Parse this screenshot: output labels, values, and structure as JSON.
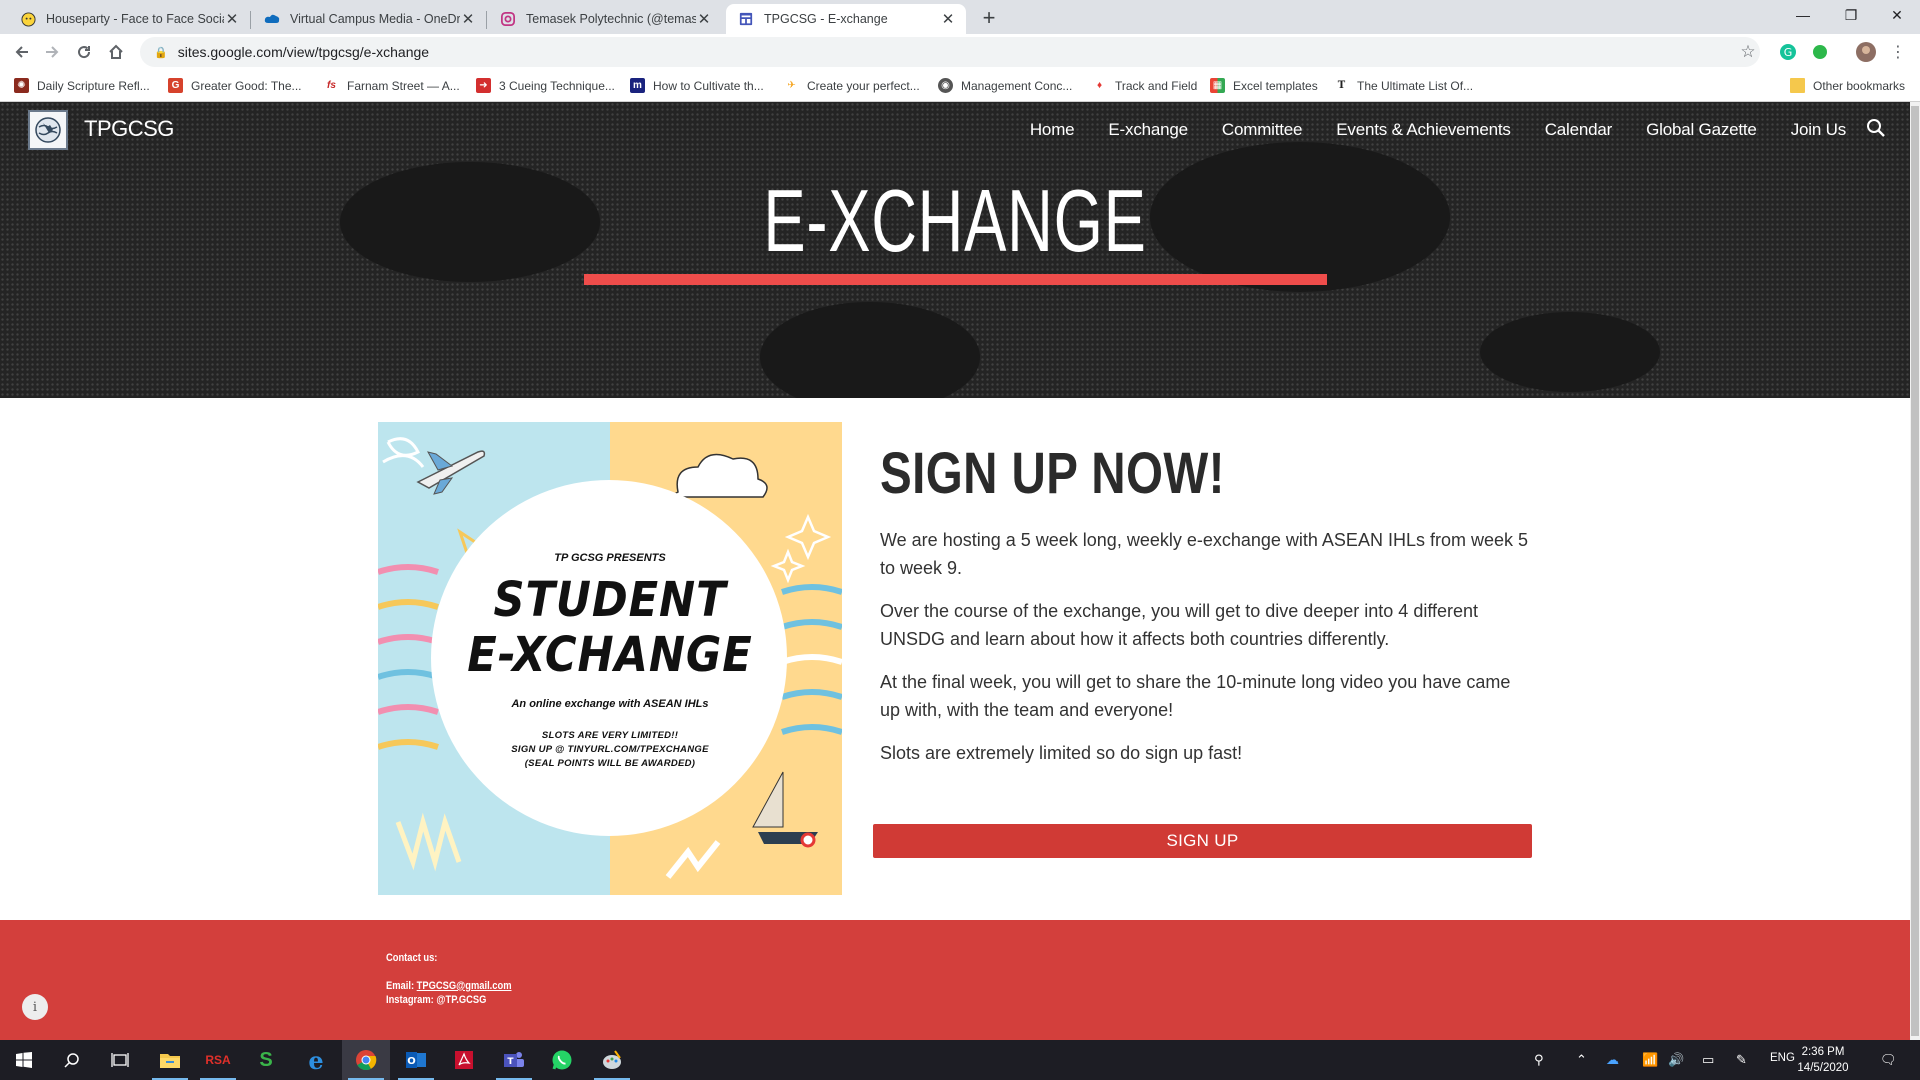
{
  "browser": {
    "tabs": [
      {
        "title": "Houseparty - Face to Face Social",
        "icon": "houseparty-icon",
        "active": false
      },
      {
        "title": "Virtual Campus Media - OneDrive",
        "icon": "onedrive-icon",
        "active": false
      },
      {
        "title": "Temasek Polytechnic (@temasekp",
        "icon": "instagram-icon",
        "active": false
      },
      {
        "title": "TPGCSG - E-xchange",
        "icon": "google-sites-icon",
        "active": true
      }
    ],
    "url": "sites.google.com/view/tpgcsg/e-xchange",
    "bookmarks": [
      {
        "label": "Daily Scripture Refl...",
        "color": "#8b2a1e"
      },
      {
        "label": "Greater Good: The...",
        "color": "#d6422c"
      },
      {
        "label": "Farnam Street — A...",
        "color": "#c62828"
      },
      {
        "label": "3 Cueing Technique...",
        "color": "#d32f2f"
      },
      {
        "label": "How to Cultivate th...",
        "color": "#1a237e"
      },
      {
        "label": "Create your perfect...",
        "color": "#f5a623"
      },
      {
        "label": "Management Conc...",
        "color": "#555555"
      },
      {
        "label": "Track and Field",
        "color": "#e53935"
      },
      {
        "label": "Excel templates",
        "color": "#2e7d32"
      },
      {
        "label": "The Ultimate List Of...",
        "color": "#222222"
      }
    ],
    "other_bookmarks": "Other bookmarks"
  },
  "site": {
    "name": "TPGCSG",
    "nav": [
      "Home",
      "E-xchange",
      "Committee",
      "Events & Achievements",
      "Calendar",
      "Global Gazette",
      "Join Us"
    ],
    "page_title": "E-XCHANGE",
    "accent_color": "#ef4d4b"
  },
  "poster": {
    "presents": "TP GCSG PRESENTS",
    "title_line1": "STUDENT",
    "title_line2": "E-XCHANGE",
    "subtitle": "An online exchange with ASEAN IHLs",
    "line1": "SLOTS ARE VERY LIMITED!!",
    "line2": "SIGN UP @ TINYURL.COM/TPEXCHANGE",
    "line3": "(SEAL POINTS WILL BE AWARDED)"
  },
  "main": {
    "heading": "SIGN UP NOW!",
    "paragraphs": [
      "We are hosting a 5 week long, weekly e-exchange with ASEAN IHLs from week 5 to week 9.",
      "Over the course of the exchange, you will get to dive deeper into 4 different UNSDG and learn about how it affects both countries differently.",
      "At the final week, you will get to share the 10-minute long video you have came up with, with the team and everyone!",
      "Slots are extremely limited so do sign up fast!"
    ],
    "button_label": "SIGN UP"
  },
  "footer": {
    "contact_heading": "Contact us:",
    "email_label": "Email: ",
    "email": "TPGCSG@gmail.com",
    "instagram": "Instagram: @TP.GCSG"
  },
  "taskbar": {
    "time": "2:36 PM",
    "date": "14/5/2020",
    "language": "ENG",
    "apps": [
      "file-explorer-icon",
      "rsa-icon",
      "s-app-icon",
      "edge-icon",
      "chrome-icon",
      "outlook-icon",
      "acrobat-icon",
      "teams-icon",
      "whatsapp-icon",
      "paint-icon"
    ]
  }
}
